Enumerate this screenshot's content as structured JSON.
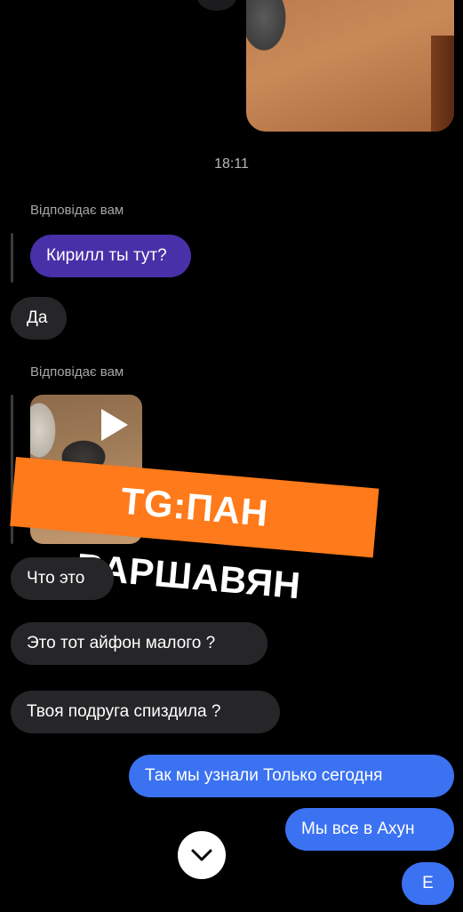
{
  "timestamp": "18:11",
  "reply_label": "Відповідає вам",
  "messages": {
    "reply_1_text": "Кирилл ты тут?",
    "msg_da": "Да",
    "msg_chto": "Что это",
    "msg_iphone": "Это тот айфон малого ?",
    "msg_podruga": "Твоя подруга спиздила ?",
    "out_1": "Так мы узнали Только сегодня",
    "out_2": "Мы все в Ахун",
    "out_3": "Е"
  },
  "watermark_text": "TG:ПАН ВАРШАВЯН",
  "icons": {
    "play": "play-icon",
    "scroll_down": "chevron-down-icon"
  },
  "colors": {
    "incoming": "#262629",
    "outgoing": "#3b72f2",
    "reply_quote": "#4730a8",
    "watermark": "#ff7a1a"
  }
}
